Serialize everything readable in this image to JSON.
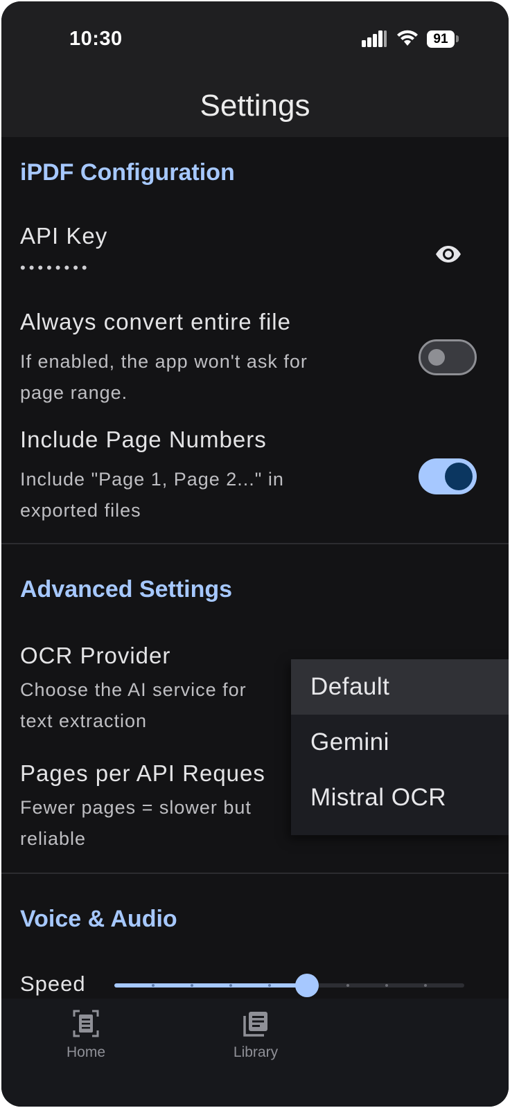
{
  "status": {
    "time": "10:30",
    "battery": "91"
  },
  "header": {
    "title": "Settings"
  },
  "sections": {
    "ipdf": {
      "title": "iPDF Configuration",
      "api_key": {
        "label": "API Key",
        "value": "••••••••"
      },
      "convert_entire": {
        "label": "Always convert entire file",
        "desc_line1": "If enabled, the app won't ask for",
        "desc_line2": "page range.",
        "enabled": false
      },
      "page_numbers": {
        "label": "Include Page Numbers",
        "desc_line1": "Include \"Page 1, Page 2...\" in",
        "desc_line2": "exported files",
        "enabled": true
      }
    },
    "advanced": {
      "title": "Advanced Settings",
      "ocr_provider": {
        "label": "OCR Provider",
        "desc_line1": "Choose the AI service for",
        "desc_line2": "text extraction"
      },
      "pages_per_request": {
        "label": "Pages per API Reques",
        "desc_line1": "Fewer pages = slower but",
        "desc_line2": "reliable"
      }
    },
    "voice": {
      "title": "Voice & Audio",
      "speed_label": "Speed",
      "speed_fraction": 0.55
    }
  },
  "ocr_dropdown": {
    "options": [
      "Default",
      "Gemini",
      "Mistral OCR"
    ],
    "selected": "Default"
  },
  "tabbar": {
    "home_label": "Home",
    "library_label": "Library"
  },
  "colors": {
    "accent": "#a6c8ff",
    "background": "#131315",
    "header": "#1f1f21"
  }
}
